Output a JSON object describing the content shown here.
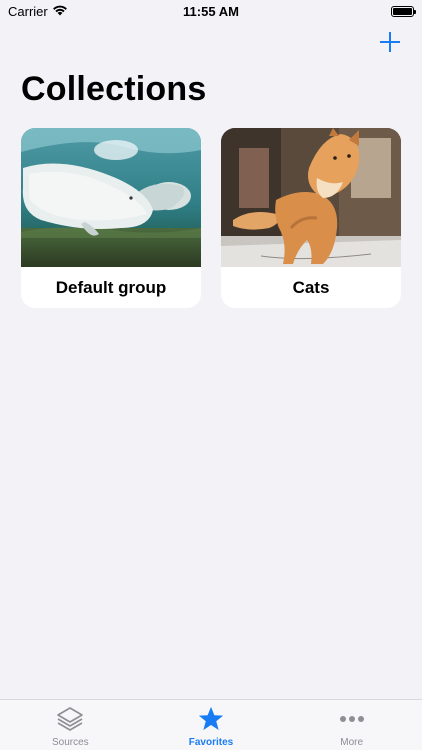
{
  "status_bar": {
    "carrier": "Carrier",
    "time": "11:55 AM",
    "icons": [
      "wifi-icon",
      "battery-icon"
    ]
  },
  "nav": {
    "add_icon": "plus-icon",
    "title": "Collections"
  },
  "collections": [
    {
      "label": "Default group",
      "image": "beluga-whales-photo"
    },
    {
      "label": "Cats",
      "image": "orange-cat-photo"
    }
  ],
  "tab_bar": {
    "tabs": [
      {
        "label": "Sources",
        "icon": "layers-icon",
        "active": false
      },
      {
        "label": "Favorites",
        "icon": "star-icon",
        "active": true
      },
      {
        "label": "More",
        "icon": "ellipsis-icon",
        "active": false
      }
    ]
  },
  "colors": {
    "background": "#f2f2f7",
    "accent": "#1a7cf5",
    "inactive": "#8e8e93",
    "card": "#ffffff"
  }
}
